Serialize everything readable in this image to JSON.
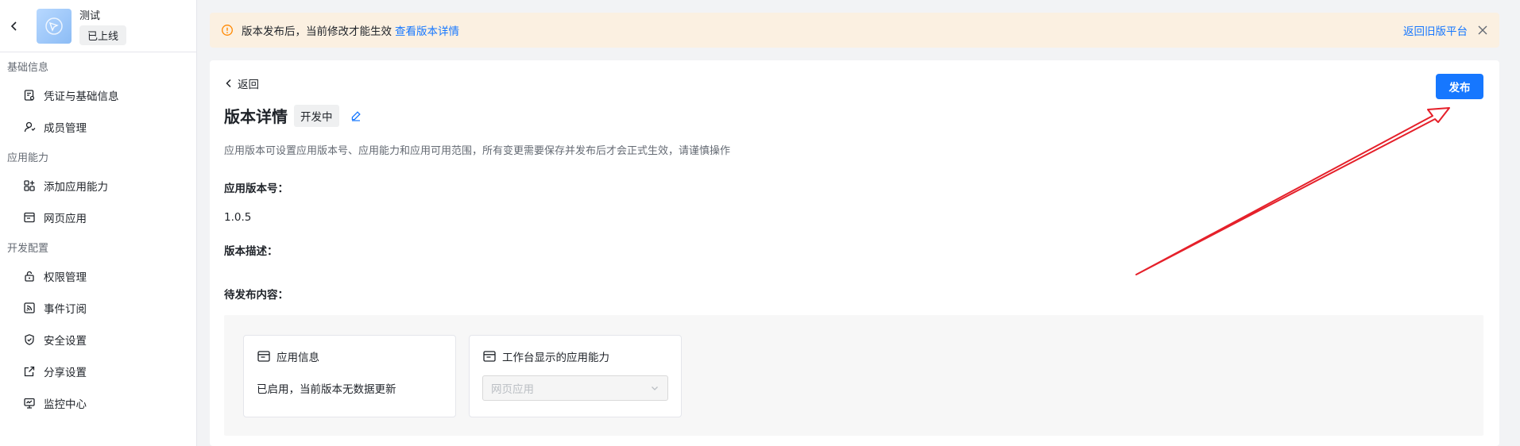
{
  "sidebar": {
    "app_name": "测试",
    "app_status": "已上线",
    "groups": [
      {
        "title": "基础信息",
        "items": [
          {
            "label": "凭证与基础信息",
            "icon": "credential-icon"
          },
          {
            "label": "成员管理",
            "icon": "user-icon"
          }
        ]
      },
      {
        "title": "应用能力",
        "items": [
          {
            "label": "添加应用能力",
            "icon": "add-capability-icon"
          },
          {
            "label": "网页应用",
            "icon": "web-app-icon"
          }
        ]
      },
      {
        "title": "开发配置",
        "items": [
          {
            "label": "权限管理",
            "icon": "lock-icon"
          },
          {
            "label": "事件订阅",
            "icon": "rss-icon"
          },
          {
            "label": "安全设置",
            "icon": "shield-icon"
          },
          {
            "label": "分享设置",
            "icon": "share-icon"
          },
          {
            "label": "监控中心",
            "icon": "monitor-icon"
          }
        ]
      }
    ]
  },
  "notice": {
    "text": "版本发布后，当前修改才能生效",
    "link": "查看版本详情",
    "back_old": "返回旧版平台"
  },
  "main": {
    "back": "返回",
    "title": "版本详情",
    "status_tag": "开发中",
    "publish": "发布",
    "description": "应用版本可设置应用版本号、应用能力和应用可用范围，所有变更需要保存并发布后才会正式生效，请谨慎操作",
    "version_label": "应用版本号：",
    "version_value": "1.0.5",
    "version_desc_label": "版本描述：",
    "pending_label": "待发布内容：",
    "cards": [
      {
        "title": "应用信息",
        "body": "已启用，当前版本无数据更新"
      },
      {
        "title": "工作台显示的应用能力",
        "select_value": "网页应用"
      }
    ]
  },
  "colors": {
    "accent": "#1677ff",
    "notice_bg": "#fbf0e1",
    "warning": "#ff8800",
    "annotation_arrow": "#e5202a"
  }
}
